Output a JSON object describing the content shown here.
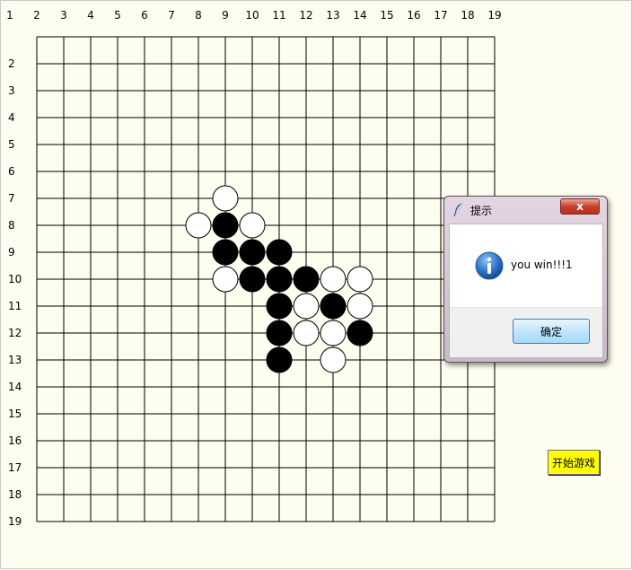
{
  "board": {
    "size": 19,
    "column_labels": [
      "1",
      "2",
      "3",
      "4",
      "5",
      "6",
      "7",
      "8",
      "9",
      "10",
      "11",
      "12",
      "13",
      "14",
      "15",
      "16",
      "17",
      "18",
      "19"
    ],
    "row_labels": [
      "2",
      "3",
      "4",
      "5",
      "6",
      "7",
      "8",
      "9",
      "10",
      "11",
      "12",
      "13",
      "14",
      "15",
      "16",
      "17",
      "18",
      "19"
    ],
    "stones": [
      {
        "col": 9,
        "row": 7,
        "color": "white"
      },
      {
        "col": 8,
        "row": 8,
        "color": "white"
      },
      {
        "col": 9,
        "row": 8,
        "color": "black"
      },
      {
        "col": 10,
        "row": 8,
        "color": "white"
      },
      {
        "col": 9,
        "row": 9,
        "color": "black"
      },
      {
        "col": 10,
        "row": 9,
        "color": "black"
      },
      {
        "col": 11,
        "row": 9,
        "color": "black"
      },
      {
        "col": 9,
        "row": 10,
        "color": "white"
      },
      {
        "col": 10,
        "row": 10,
        "color": "black"
      },
      {
        "col": 11,
        "row": 10,
        "color": "black"
      },
      {
        "col": 12,
        "row": 10,
        "color": "black"
      },
      {
        "col": 13,
        "row": 10,
        "color": "white"
      },
      {
        "col": 14,
        "row": 10,
        "color": "white"
      },
      {
        "col": 11,
        "row": 11,
        "color": "black"
      },
      {
        "col": 12,
        "row": 11,
        "color": "white"
      },
      {
        "col": 13,
        "row": 11,
        "color": "black"
      },
      {
        "col": 14,
        "row": 11,
        "color": "white"
      },
      {
        "col": 11,
        "row": 12,
        "color": "black"
      },
      {
        "col": 12,
        "row": 12,
        "color": "white"
      },
      {
        "col": 13,
        "row": 12,
        "color": "white"
      },
      {
        "col": 14,
        "row": 12,
        "color": "black"
      },
      {
        "col": 11,
        "row": 13,
        "color": "black"
      },
      {
        "col": 13,
        "row": 13,
        "color": "white"
      }
    ]
  },
  "controls": {
    "start_label": "开始游戏",
    "start_color": "#ffff00"
  },
  "dialog": {
    "title": "提示",
    "message": "you win!!!1",
    "ok_label": "确定",
    "close_glyph": "x",
    "title_icon": "feather-icon",
    "message_icon": "info-icon"
  },
  "colors": {
    "background": "#fdfdf0",
    "grid": "#000000",
    "black_stone": "#000000",
    "white_stone": "#ffffff"
  }
}
